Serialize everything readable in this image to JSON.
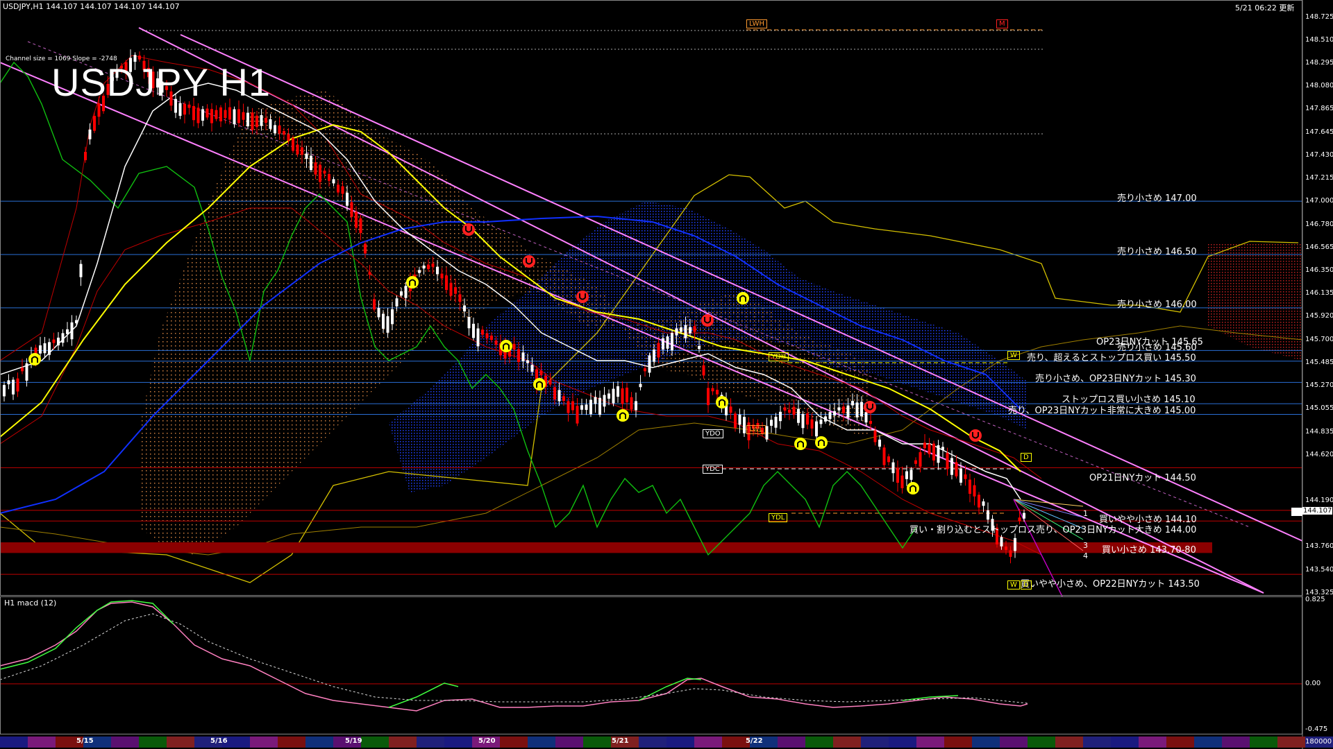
{
  "header": {
    "symbol_line": "USDJPY,H1  144.107 144.107 144.107 144.107",
    "timestamp": "5/21 06:22 更新",
    "channel_info": "Channel size = 1069 Slope = -2748",
    "big_title": "USDJPY H1"
  },
  "price_axis": {
    "labels": [
      "148.725",
      "148.510",
      "148.295",
      "148.080",
      "147.865",
      "147.645",
      "147.430",
      "147.215",
      "147.000",
      "146.780",
      "146.565",
      "146.350",
      "146.135",
      "145.920",
      "145.700",
      "145.485",
      "145.270",
      "145.055",
      "144.835",
      "144.620",
      "144.190",
      "143.760",
      "143.540",
      "143.325"
    ],
    "current_price": "144.107"
  },
  "macd_axis": {
    "labels": [
      "0.825",
      "0.00",
      "-0.475",
      "180000"
    ]
  },
  "subwindow": {
    "title": "H1  macd (12)"
  },
  "dates": [
    "5/15",
    "5/16",
    "5/19",
    "5/20",
    "5/21",
    "5/22"
  ],
  "markers": {
    "lwh": "LWH",
    "m": "M",
    "ydh": "YDH",
    "ydo": "YDO",
    "ydc": "YDC",
    "lwl": "LWL",
    "ydl": "YDL",
    "w1": "W",
    "w2": "W",
    "d1": "D",
    "d2": "D",
    "n1": "1",
    "n3": "3",
    "n4": "4"
  },
  "annotations": [
    "売り小さめ 147.00",
    "売り小さめ 146.50",
    "売り小さめ 146.00",
    "OP23日NYカット 145.65",
    "売り小さめ 145.60",
    "売り、超えるとストップロス買い 145.50",
    "売り小さめ、OP23日NYカット 145.30",
    "ストップロス買い小さめ 145.10",
    "売り、OP23日NYカット非常に大きめ 145.00",
    "OP21日NYカット 144.50",
    "買いやや小さめ 144.10",
    "買い・割り込むとストップロス売り、OP23日NYカット大きめ 144.00",
    "買い小さめ 143.70-80",
    "買いやや小さめ、OP22日NYカット 143.50"
  ],
  "colors": {
    "background": "#000000",
    "grid_blue": "#2a6fd6",
    "level_red": "#c00000",
    "band_red": "#8b0000",
    "sma_white": "#ffffff",
    "sma_yellow": "#ffff00",
    "sma_blue": "#1030ff",
    "channel_pink": "#ff80ff",
    "chikou_green": "#10c010",
    "kumo_blue": "#2040ff",
    "kumo_orange": "#d08040",
    "bull": "#ffffff",
    "bear": "#ff0000"
  }
}
